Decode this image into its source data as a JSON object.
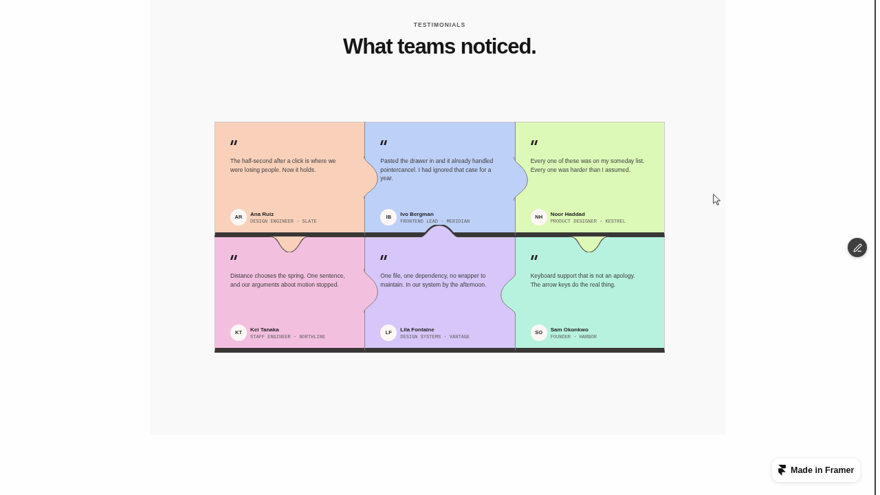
{
  "section": {
    "eyebrow": "TESTIMONIALS",
    "title": "What teams noticed."
  },
  "testimonials": [
    {
      "quote": "The half-second after a click is where we were losing people. Now it holds.",
      "initials": "AR",
      "name": "Ana Ruiz",
      "role": "DESIGN ENGINEER · SLATE",
      "color": "#f9d0ba"
    },
    {
      "quote": "Pasted the drawer in and it already handled pointercancel. I had ignored that case for a year.",
      "initials": "IB",
      "name": "Ivo Bergman",
      "role": "FRONTEND LEAD · MERIDIAN",
      "color": "#bdd0f8"
    },
    {
      "quote": "Every one of these was on my someday list. Every one was harder than I assumed.",
      "initials": "NH",
      "name": "Noor Haddad",
      "role": "PRODUCT DESIGNER · KESTREL",
      "color": "#dcf9b7"
    },
    {
      "quote": "Distance chooses the spring. One sentence, and our arguments about motion stopped.",
      "initials": "KT",
      "name": "Kei Tanaka",
      "role": "STAFF ENGINEER · NORTHLINE",
      "color": "#f3bfdf"
    },
    {
      "quote": "One file, one dependency, no wrapper to maintain. In our system by the afternoon.",
      "initials": "LF",
      "name": "Lila Fontaine",
      "role": "DESIGN SYSTEMS · VANTAGE",
      "color": "#d6c6f9"
    },
    {
      "quote": "Keyboard support that is not an apology. The arrow keys do the real thing.",
      "initials": "SO",
      "name": "Sam Okonkwo",
      "role": "FOUNDER · HARBOR",
      "color": "#b7f2de"
    }
  ],
  "badge": {
    "label": "Made in Framer"
  }
}
